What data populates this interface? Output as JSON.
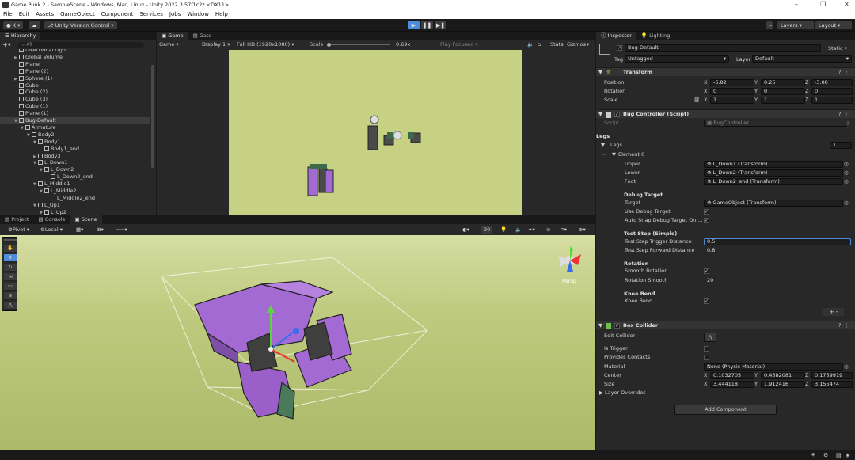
{
  "window": {
    "title": "Game Punk 2 - SampleScene - Windows, Mac, Linux - Unity 2022.3.57f1c2* <DX11>",
    "min": "–",
    "max": "❐",
    "close": "✕"
  },
  "menu": [
    "File",
    "Edit",
    "Assets",
    "GameObject",
    "Component",
    "Services",
    "Jobs",
    "Window",
    "Help"
  ],
  "toolbar": {
    "account": "K",
    "version_control": "Unity Version Control",
    "layers": "Layers",
    "layout": "Layout"
  },
  "hierarchy": {
    "tab": "Hierarchy",
    "search_placeholder": "All",
    "items": [
      {
        "label": "Directional Light",
        "indent": 1,
        "arrow": ""
      },
      {
        "label": "Global Volume",
        "indent": 1,
        "arrow": "▶"
      },
      {
        "label": "Plane",
        "indent": 1,
        "arrow": ""
      },
      {
        "label": "Plane (2)",
        "indent": 1,
        "arrow": ""
      },
      {
        "label": "Sphere (1)",
        "indent": 1,
        "arrow": "▶"
      },
      {
        "label": "Cube",
        "indent": 1,
        "arrow": ""
      },
      {
        "label": "Cube (2)",
        "indent": 1,
        "arrow": ""
      },
      {
        "label": "Cube (3)",
        "indent": 1,
        "arrow": ""
      },
      {
        "label": "Cube (1)",
        "indent": 1,
        "arrow": ""
      },
      {
        "label": "Plane (1)",
        "indent": 1,
        "arrow": ""
      },
      {
        "label": "Bug-Default",
        "indent": 1,
        "arrow": "▼",
        "selected": true
      },
      {
        "label": "Armature",
        "indent": 2,
        "arrow": "▼"
      },
      {
        "label": "Body2",
        "indent": 3,
        "arrow": "▼"
      },
      {
        "label": "Body1",
        "indent": 4,
        "arrow": "▼"
      },
      {
        "label": "Body1_end",
        "indent": 5,
        "arrow": ""
      },
      {
        "label": "Body3",
        "indent": 4,
        "arrow": "▶"
      },
      {
        "label": "L_Down1",
        "indent": 4,
        "arrow": "▼"
      },
      {
        "label": "L_Down2",
        "indent": 5,
        "arrow": "▼"
      },
      {
        "label": "L_Down2_end",
        "indent": 6,
        "arrow": ""
      },
      {
        "label": "L_Middle1",
        "indent": 4,
        "arrow": "▼"
      },
      {
        "label": "L_Middle2",
        "indent": 5,
        "arrow": "▼"
      },
      {
        "label": "L_Middle2_end",
        "indent": 6,
        "arrow": ""
      },
      {
        "label": "L_Up1",
        "indent": 4,
        "arrow": "▼"
      },
      {
        "label": "L_Up2",
        "indent": 5,
        "arrow": "▼"
      }
    ]
  },
  "game": {
    "tabs": [
      "Game",
      "Gate"
    ],
    "display_mode": "Game",
    "display": "Display 1",
    "resolution": "Full HD (1920x1080)",
    "scale_label": "Scale",
    "scale_value": "0.69x",
    "play_mode": "Play Focused",
    "stats": "Stats",
    "gizmos": "Gizmos"
  },
  "scene": {
    "tabs": [
      "Project",
      "Console",
      "Scene"
    ],
    "pivot": "Pivot",
    "local": "Local",
    "grid_size": "20",
    "persp": "Persp"
  },
  "inspector": {
    "tabs": [
      "Inspector",
      "Lighting"
    ],
    "object_name": "Bug-Default",
    "static": "Static",
    "tag_label": "Tag",
    "tag_value": "Untagged",
    "layer_label": "Layer",
    "layer_value": "Default",
    "transform": {
      "title": "Transform",
      "position": {
        "label": "Position",
        "x": "-6.82",
        "y": "0.25",
        "z": "-3.08"
      },
      "rotation": {
        "label": "Rotation",
        "x": "0",
        "y": "0",
        "z": "0"
      },
      "scale": {
        "label": "Scale",
        "x": "1",
        "y": "1",
        "z": "1"
      }
    },
    "bug_controller": {
      "title": "Bug Controller (Script)",
      "script_label": "Script",
      "script_value": "BugController",
      "legs_header": "Legs",
      "legs_label": "Legs",
      "legs_count": "1",
      "element": "Element 0",
      "upper_label": "Upper",
      "upper_value": "L_Down1 (Transform)",
      "lower_label": "Lower",
      "lower_value": "L_Down2 (Transform)",
      "foot_label": "Foot",
      "foot_value": "L_Down2_end (Transform)",
      "debug_header": "Debug Target",
      "target_label": "Target",
      "target_value": "GameObject (Transform)",
      "use_debug_label": "Use Debug Target",
      "auto_snap_label": "Auto Snap Debug Target On ...",
      "test_step_header": "Test Step (Simple)",
      "trigger_label": "Test Step Trigger Distance",
      "trigger_value": "0.5",
      "forward_label": "Test Step Forward Distance",
      "forward_value": "0.8",
      "rotation_header": "Rotation",
      "smooth_rot_label": "Smooth Rotation",
      "rot_smooth_label": "Rotation Smooth",
      "rot_smooth_value": "20",
      "knee_header": "Knee Bend",
      "knee_label": "Knee Bend"
    },
    "box_collider": {
      "title": "Box Collider",
      "edit_label": "Edit Collider",
      "trigger_label": "Is Trigger",
      "contacts_label": "Provides Contacts",
      "material_label": "Material",
      "material_value": "None (Physic Material)",
      "center": {
        "label": "Center",
        "x": "0.1032705",
        "y": "0.4582081",
        "z": "0.1759919"
      },
      "size": {
        "label": "Size",
        "x": "3.444118",
        "y": "1.912416",
        "z": "3.155474"
      },
      "layer_overrides": "Layer Overrides"
    },
    "add_component": "Add Component",
    "plus_minus": "+ -"
  },
  "colors": {
    "accent": "#4d8cd9",
    "bug_purple": "#a46ad4",
    "ground": "#c6d184"
  }
}
